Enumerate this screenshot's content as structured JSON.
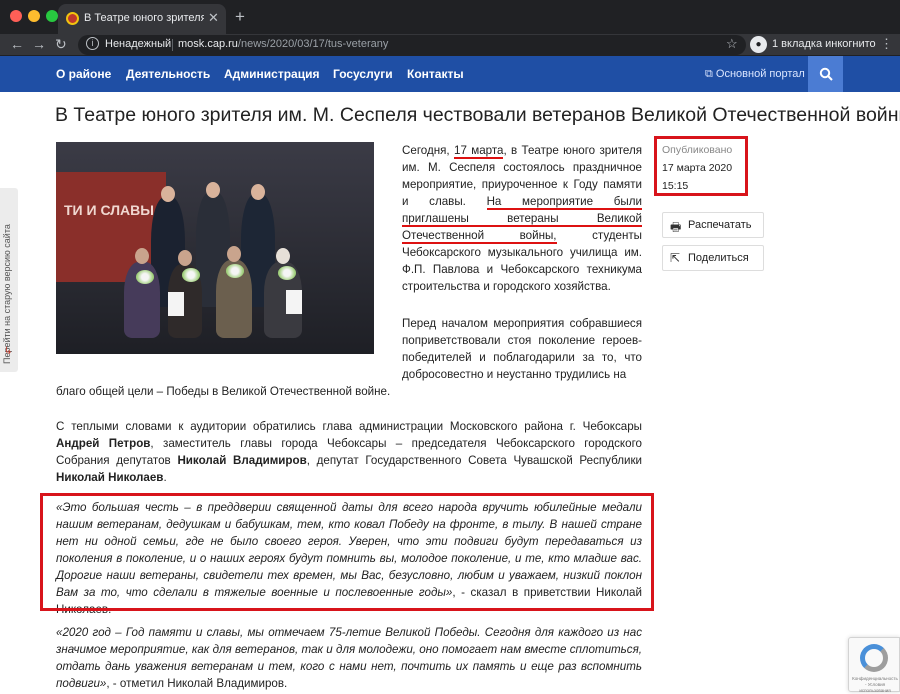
{
  "browser": {
    "tab_title": "В Театре юного зрителя им. М",
    "security": "Ненадежный",
    "url_host": "mosk.cap.ru",
    "url_path": "/news/2020/03/17/tus-veterany",
    "incognito": "1 вкладка инкогнито"
  },
  "nav": {
    "items": [
      "О районе",
      "Деятельность",
      "Администрация",
      "Госуслуги",
      "Контакты"
    ],
    "portal_link": "Основной портал"
  },
  "article": {
    "title": "В Театре юного зрителя им. М. Сеспеля чествовали ветеранов Великой Отечественной войны",
    "photo_text": "ТИ И СЛАВЫ",
    "p1_a": "Сегодня, ",
    "p1_date": "17 марта",
    "p1_b": ", в Театре юного зрителя им. М. Сеспеля состоялось праздничное мероприятие, приуроченное к Году памяти и славы. ",
    "p1_underlined": "На мероприятие были приглашены ветераны Великой Отечественной войны,",
    "p1_c": " студенты Чебоксарского музыкального училища им. Ф.П. Павлова и Чебоксарского техникума строительства и городского хозяйства.",
    "p2": "Перед началом мероприятия собравшиеся поприветствовали стоя поколение героев-победителей и поблагодарили за то, что добросовестно и неустанно трудились на",
    "p2_end": "благо общей цели – Победы в Великой Отечественной войне.",
    "p3_a": "С теплыми словами к аудитории обратились глава администрации Московского района г. Чебоксары ",
    "p3_name1": "Андрей Петров",
    "p3_b": ", заместитель главы города Чебоксары – председателя Чебоксарского городского Собрания депутатов ",
    "p3_name2": "Николай Владимиров",
    "p3_c": ", депутат Государственного Совета Чувашской Республики ",
    "p3_name3": "Николай Николаев",
    "p3_d": ".",
    "p4_quote": "«Это большая честь – в преддверии священной даты для всего народа вручить юбилейные медали нашим ветеранам, дедушкам и бабушкам, тем, кто ковал Победу на фронте, в тылу. В нашей стране нет ни одной семьи, где не было своего героя. Уверен, что эти подвиги будут передаваться из поколения в поколение, и о наших героях будут помнить вы, молодое поколение, и те, кто младше вас. Дорогие наши ветераны, свидетели тех времен, мы Вас, безусловно, любим и уважаем, низкий поклон Вам за то, что сделали в тяжелые военные и послевоенные годы»",
    "p4_tail": ", - сказал в приветствии Николай Николаев.",
    "p5_quote": "«2020 год – Год памяти и славы, мы отмечаем 75-летие Великой Победы. Сегодня для каждого из нас значимое мероприятие, как для ветеранов, так и для молодежи, оно помогает нам вместе сплотиться, отдать дань уважения ветеранам и тем, кого с нами нет, почтить их память и еще раз вспомнить подвиги»",
    "p5_tail": ", - отметил Николай Владимиров."
  },
  "sidebar": {
    "published_label": "Опубликовано",
    "published_date": "17 марта 2020",
    "published_time": "15:15",
    "print_label": "Распечатать",
    "share_label": "Поделиться"
  },
  "old_site": "Перейти на старую версию сайта",
  "recaptcha_text": "Конфиденциальность - Условия использования",
  "colors": {
    "nav_bg": "#1f4fa5",
    "highlight": "#d8141b"
  }
}
